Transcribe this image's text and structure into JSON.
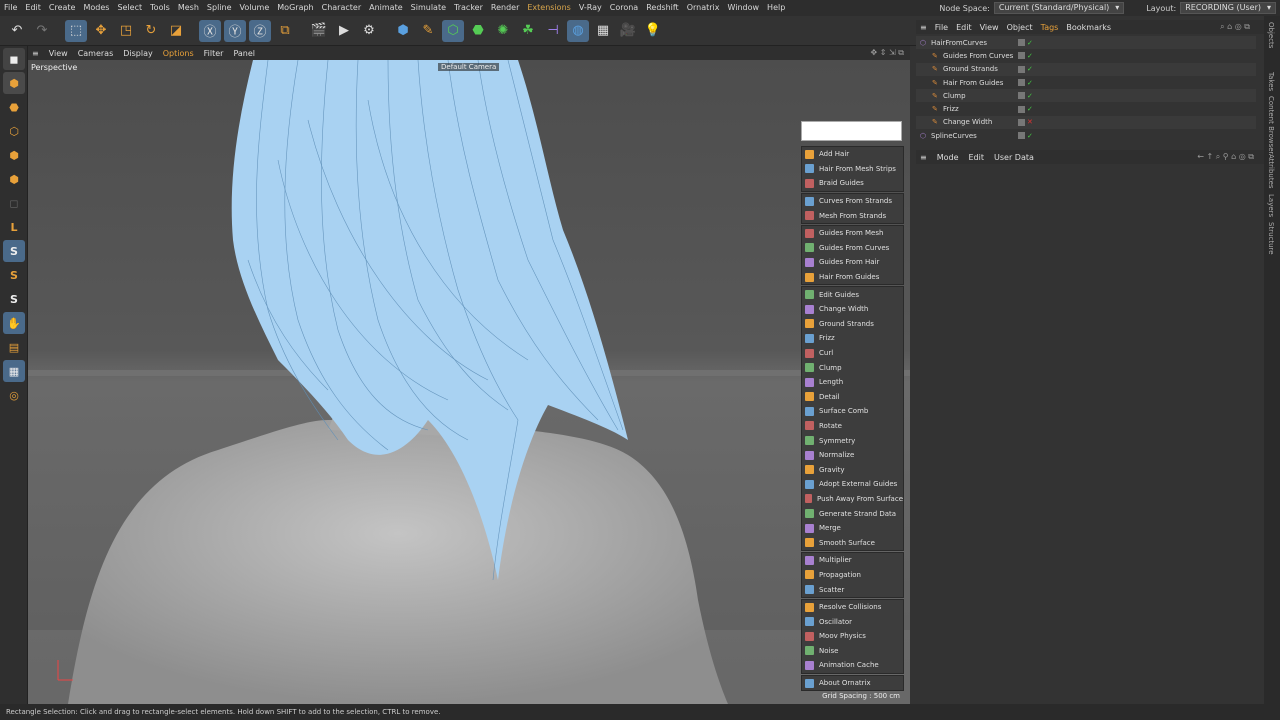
{
  "menubar": {
    "items": [
      "File",
      "Edit",
      "Create",
      "Modes",
      "Select",
      "Tools",
      "Mesh",
      "Spline",
      "Volume",
      "MoGraph",
      "Character",
      "Animate",
      "Simulate",
      "Tracker",
      "Render",
      "Extensions",
      "V-Ray",
      "Corona",
      "Redshift",
      "Ornatrix",
      "Window",
      "Help"
    ],
    "node_space_label": "Node Space:",
    "node_space_value": "Current (Standard/Physical)",
    "layout_label": "Layout:",
    "layout_value": "RECORDING (User)"
  },
  "viewport": {
    "menu": [
      "View",
      "Cameras",
      "Display",
      "Options",
      "Filter",
      "Panel"
    ],
    "label": "Perspective",
    "camera": "Default Camera",
    "grid_spacing": "Grid Spacing : 500 cm"
  },
  "ornatrix_menu": {
    "groups": [
      [
        "Add Hair",
        "Hair From Mesh Strips",
        "Braid Guides"
      ],
      [
        "Curves From Strands",
        "Mesh From Strands"
      ],
      [
        "Guides From Mesh",
        "Guides From Curves",
        "Guides From Hair",
        "Hair From Guides"
      ],
      [
        "Edit Guides",
        "Change Width",
        "Ground Strands",
        "Frizz",
        "Curl",
        "Clump",
        "Length",
        "Detail",
        "Surface Comb",
        "Rotate",
        "Symmetry",
        "Normalize",
        "Gravity",
        "Adopt External Guides",
        "Push Away From Surface",
        "Generate Strand Data",
        "Merge",
        "Smooth Surface"
      ],
      [
        "Multiplier",
        "Propagation",
        "Scatter"
      ],
      [
        "Resolve Collisions",
        "Oscillator",
        "Moov Physics",
        "Noise",
        "Animation Cache"
      ],
      [
        "About Ornatrix"
      ]
    ]
  },
  "object_manager": {
    "menu": [
      "File",
      "Edit",
      "View",
      "Object",
      "Tags",
      "Bookmarks"
    ],
    "rows": [
      {
        "name": "HairFromCurves",
        "indent": 0
      },
      {
        "name": "Guides From Curves",
        "indent": 1
      },
      {
        "name": "Ground Strands",
        "indent": 1
      },
      {
        "name": "Hair From Guides",
        "indent": 1
      },
      {
        "name": "Clump",
        "indent": 1
      },
      {
        "name": "Frizz",
        "indent": 1
      },
      {
        "name": "Change Width",
        "indent": 1
      },
      {
        "name": "SplineCurves",
        "indent": 0
      }
    ]
  },
  "attribute_manager": {
    "menu": [
      "Mode",
      "Edit",
      "User Data"
    ]
  },
  "side_tabs": [
    "Objects",
    "Takes",
    "Content Browser",
    "Attributes",
    "Layers",
    "Structure"
  ],
  "status": "Rectangle Selection: Click and drag to rectangle-select elements. Hold down SHIFT to add to the selection, CTRL to remove."
}
